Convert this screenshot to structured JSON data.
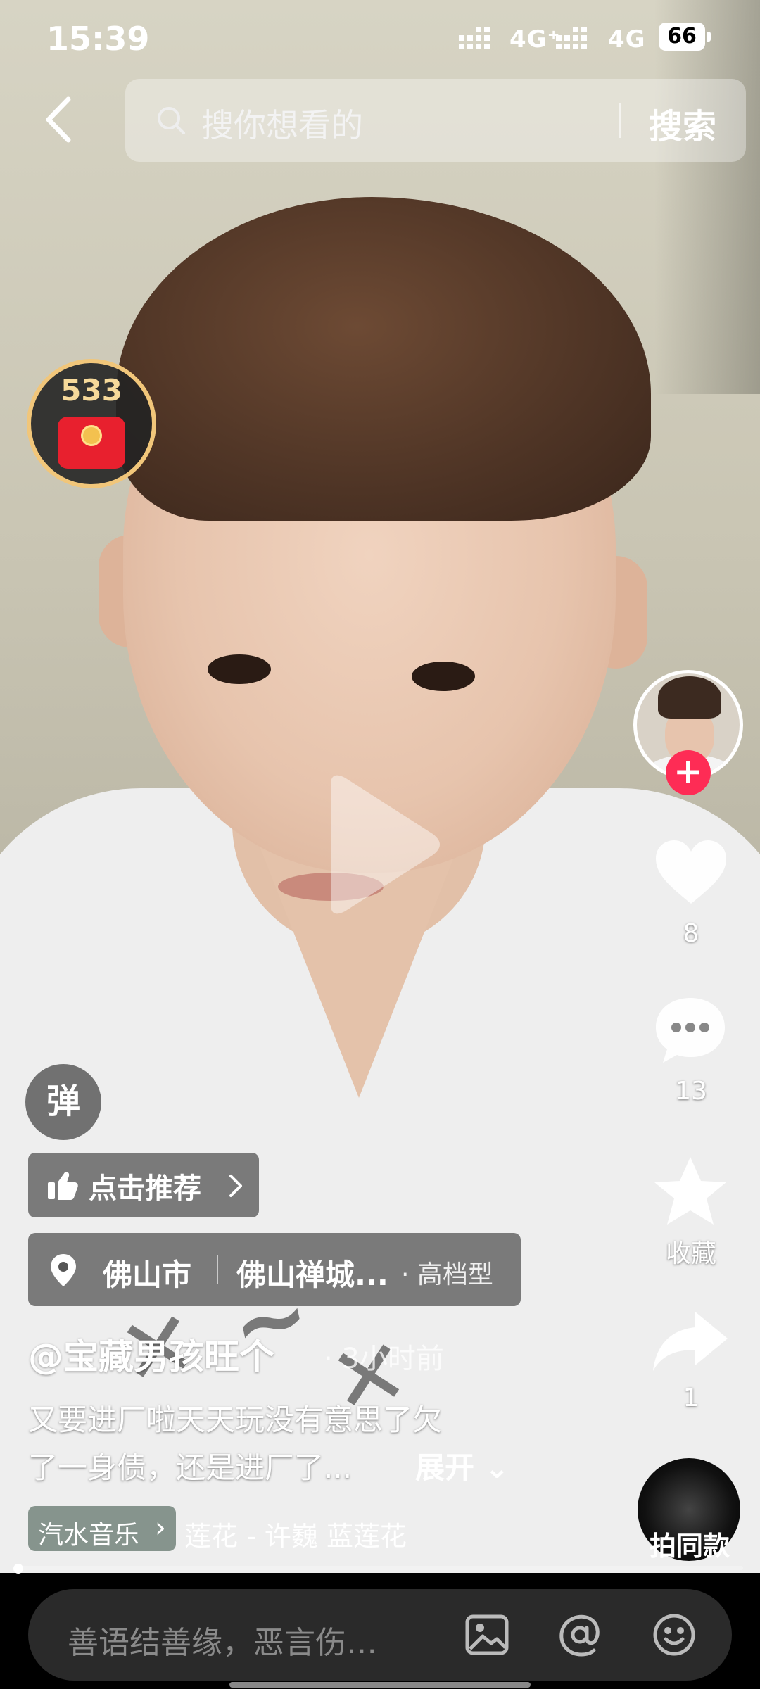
{
  "status_bar": {
    "time": "15:39",
    "signal1": "4G⁺",
    "signal2": "4G",
    "battery": "66"
  },
  "search": {
    "placeholder": "搜你想看的",
    "button_label": "搜索"
  },
  "red_packet": {
    "count": "533"
  },
  "danmu": {
    "label": "弹"
  },
  "right_rail": {
    "likes": "8",
    "comments": "13",
    "favorite_label": "收藏",
    "shares": "1",
    "same_style_label": "拍同款"
  },
  "recommend": {
    "label": "点击推荐"
  },
  "location": {
    "city": "佛山市",
    "place": "佛山禅城...",
    "type": "· 高档型"
  },
  "post": {
    "author": "@宝藏男孩旺个",
    "time_ago": "· 3小时前",
    "desc_line1": "又要进厂啦天天玩没有意思了欠",
    "desc_line2": "了一身债，还是进厂了...",
    "expand_label": "展开"
  },
  "music": {
    "tag": "汽水音乐",
    "title": "莲花 - 许巍    蓝莲花"
  },
  "progress": {
    "fraction": 0.0
  },
  "comment_bar": {
    "placeholder": "善语结善缘，恶言伤…"
  },
  "colors": {
    "accent_red": "#fe2c55",
    "packet_gold": "#f1c67a"
  }
}
